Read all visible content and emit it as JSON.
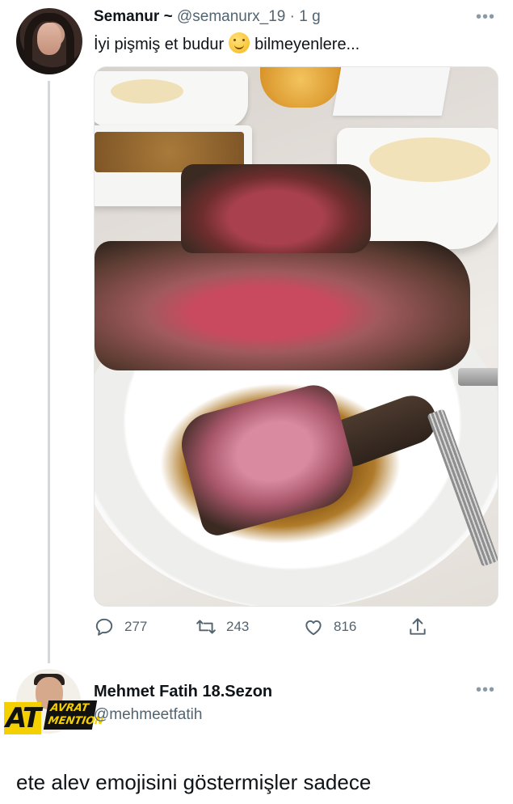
{
  "tweet": {
    "author_name": "Semanur ~",
    "handle": "@semanurx_19",
    "separator": "·",
    "time": "1 g",
    "text_before": "İyi pişmiş et budur",
    "emoji": "smiling-face-emoji",
    "text_after": "bilmeyenlere...",
    "more": "•••",
    "media_alt": "steak on plate",
    "stats": {
      "replies": "277",
      "retweets": "243",
      "likes": "816"
    }
  },
  "reply": {
    "author_name": "Mehmet Fatih 18.Sezon",
    "handle": "@mehmeetfatih",
    "more": "•••",
    "badge_big": "AT",
    "badge_line1": "AVRAT",
    "badge_line2": "MENTION",
    "text": "ete alev emojisini göstermişler sadece"
  },
  "colors": {
    "text": "#0f1419",
    "muted": "#536471",
    "thread_line": "#cfd9de",
    "badge_yellow": "#f5d000"
  }
}
